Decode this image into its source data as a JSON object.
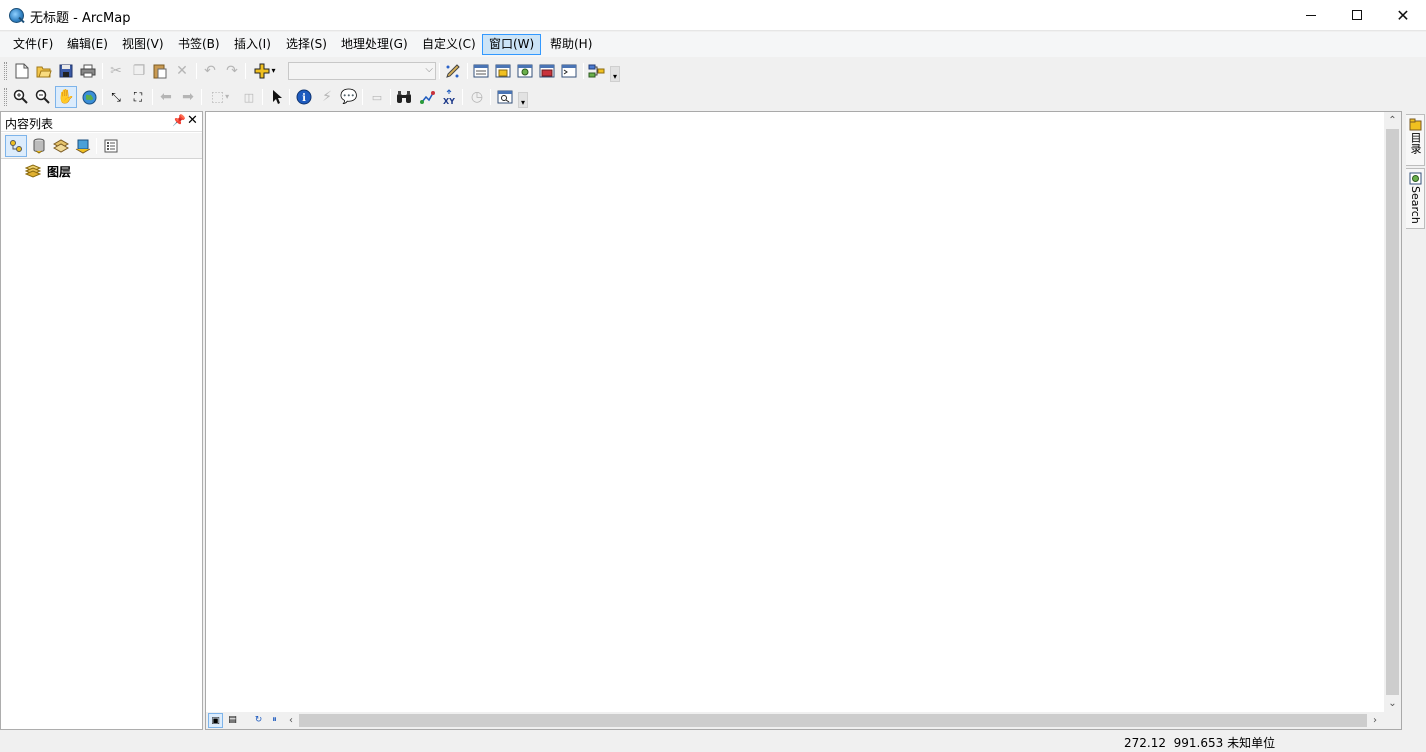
{
  "window": {
    "title": "无标题 - ArcMap"
  },
  "menu": [
    {
      "label": "文件(F)"
    },
    {
      "label": "编辑(E)"
    },
    {
      "label": "视图(V)"
    },
    {
      "label": "书签(B)"
    },
    {
      "label": "插入(I)"
    },
    {
      "label": "选择(S)"
    },
    {
      "label": "地理处理(G)"
    },
    {
      "label": "自定义(C)"
    },
    {
      "label": "窗口(W)",
      "active": true
    },
    {
      "label": "帮助(H)"
    }
  ],
  "toolbar": {
    "scale_value": ""
  },
  "toc": {
    "title": "内容列表",
    "tree": {
      "root_label": "图层"
    }
  },
  "dock": {
    "catalog_label": "目录",
    "search_label": "Search"
  },
  "status": {
    "x": "272.12",
    "y": "991.653",
    "units": "未知单位"
  },
  "colors": {
    "menu_active_bg": "#cce4f7",
    "menu_active_border": "#3399ff",
    "pressed_bg": "#dcecfc"
  },
  "icons": {
    "toolbar_standard": [
      "new-document-icon",
      "open-icon",
      "save-icon",
      "print-icon",
      "cut-icon",
      "copy-icon",
      "paste-icon",
      "delete-icon",
      "undo-icon",
      "redo-icon",
      "add-data-icon",
      "editor-toolbar-icon",
      "toc-window-icon",
      "catalog-window-icon",
      "search-window-icon",
      "arctoolbox-icon",
      "python-window-icon",
      "model-builder-icon"
    ],
    "toolbar_tools": [
      "zoom-in-icon",
      "zoom-out-icon",
      "pan-icon",
      "full-extent-icon",
      "fixed-zoom-in-icon",
      "fixed-zoom-out-icon",
      "back-extent-icon",
      "forward-extent-icon",
      "select-features-icon",
      "clear-selection-icon",
      "select-elements-icon",
      "identify-icon",
      "hyperlink-icon",
      "html-popup-icon",
      "measure-icon",
      "find-icon",
      "find-route-icon",
      "go-to-xy-icon",
      "time-slider-icon",
      "create-viewer-window-icon"
    ]
  }
}
